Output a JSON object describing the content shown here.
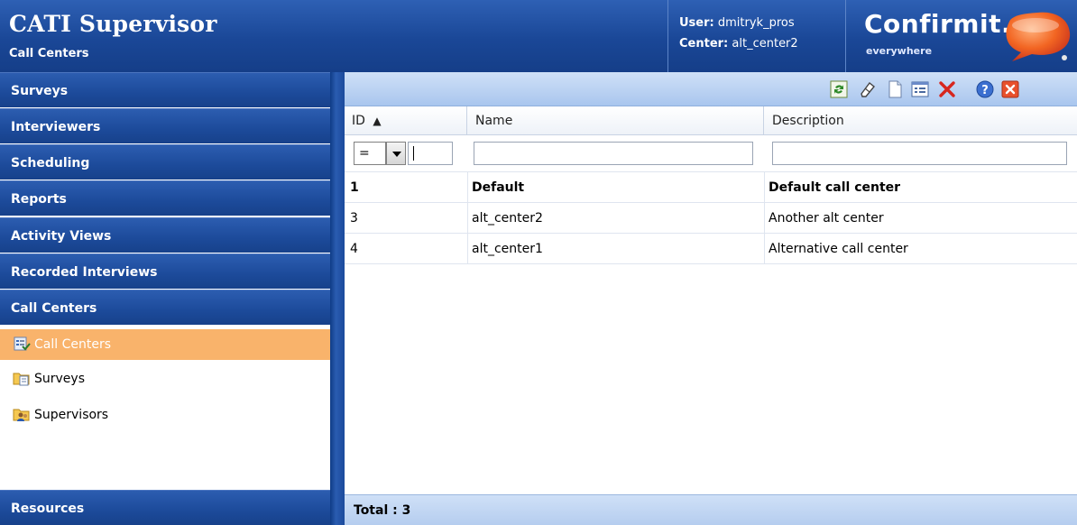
{
  "header": {
    "title": "CATI Supervisor",
    "subtitle": "Call Centers",
    "user_label": "User:",
    "user_value": "dmitryk_pros",
    "center_label": "Center:",
    "center_value": "alt_center2",
    "logo_word": "Confirmit.",
    "logo_tagline": "everywhere",
    "colors": {
      "header_blue": "#1a4797",
      "logo_orange": "#f26522",
      "logo_red": "#e8452b"
    }
  },
  "sidebar": {
    "sections": [
      {
        "label": "Surveys"
      },
      {
        "label": "Interviewers"
      },
      {
        "label": "Scheduling"
      },
      {
        "label": "Reports"
      },
      {
        "label": "Activity Views"
      },
      {
        "label": "Recorded Interviews"
      },
      {
        "label": "Call Centers"
      }
    ],
    "items": [
      {
        "label": "Call Centers",
        "icon": "call-center-list-icon",
        "active": true
      },
      {
        "label": "Surveys",
        "icon": "folder-surveys-icon"
      },
      {
        "label": "Supervisors",
        "icon": "folder-users-icon"
      }
    ],
    "bottom_section": "Resources",
    "colors": {
      "active_item": "#f9b36b"
    }
  },
  "toolbar": {
    "buttons": [
      "refresh-icon",
      "eraser-icon",
      "new-document-icon",
      "properties-icon",
      "delete-icon",
      "help-icon",
      "close-icon"
    ]
  },
  "grid": {
    "columns": [
      "ID",
      "Name",
      "Description"
    ],
    "sort_indicator": "▲",
    "filter_operator": "=",
    "rows": [
      {
        "id": "1",
        "name": "Default",
        "description": "Default call center",
        "bold": true
      },
      {
        "id": "3",
        "name": "alt_center2",
        "description": "Another alt center"
      },
      {
        "id": "4",
        "name": "alt_center1",
        "description": "Alternative call center"
      }
    ],
    "total_label": "Total : 3"
  }
}
